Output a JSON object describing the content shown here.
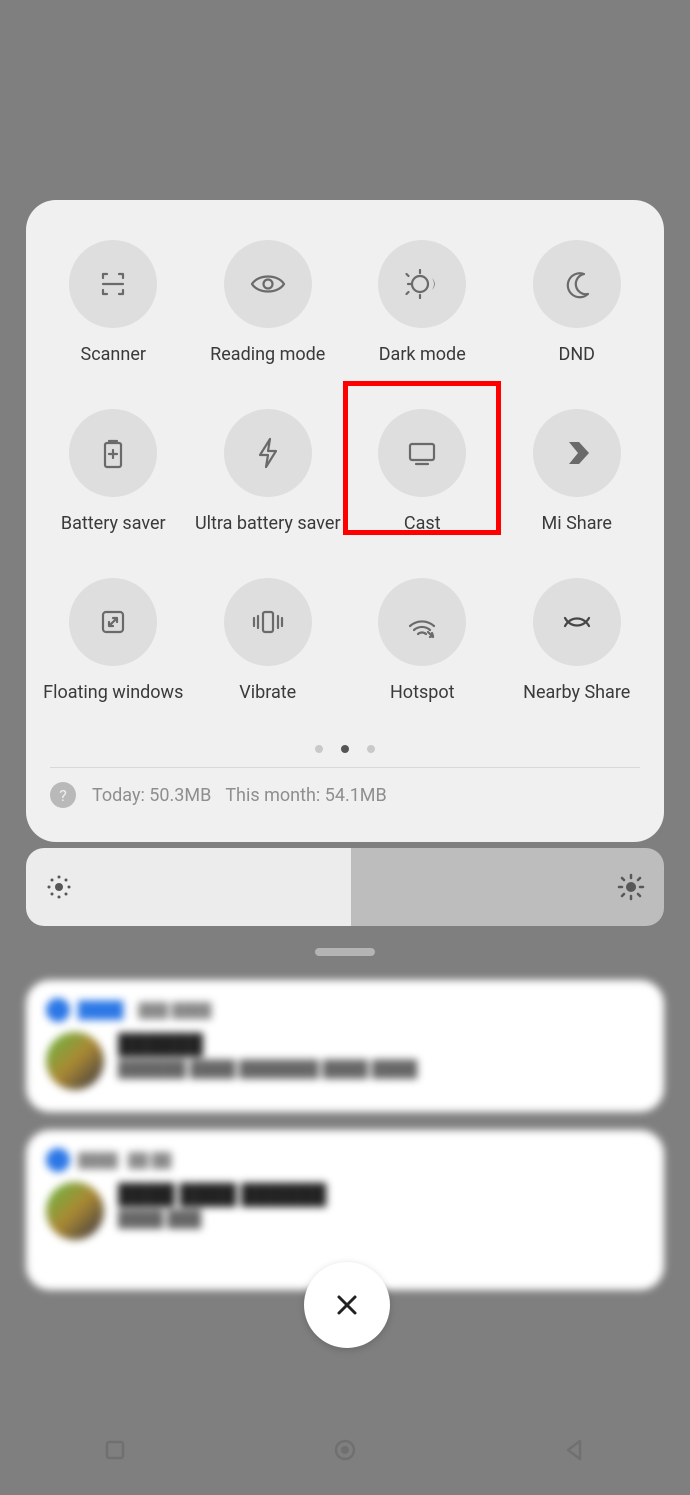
{
  "tiles": [
    {
      "label": "Scanner",
      "icon": "scanner-icon",
      "highlighted": false
    },
    {
      "label": "Reading mode",
      "icon": "eye-icon",
      "highlighted": false
    },
    {
      "label": "Dark mode",
      "icon": "dark-mode-icon",
      "highlighted": false
    },
    {
      "label": "DND",
      "icon": "moon-icon",
      "highlighted": false
    },
    {
      "label": "Battery saver",
      "icon": "battery-plus-icon",
      "highlighted": false
    },
    {
      "label": "Ultra battery saver",
      "icon": "bolt-icon",
      "highlighted": false
    },
    {
      "label": "Cast",
      "icon": "cast-icon",
      "highlighted": true
    },
    {
      "label": "Mi Share",
      "icon": "mishare-icon",
      "highlighted": false
    },
    {
      "label": "Floating windows",
      "icon": "floating-icon",
      "highlighted": false
    },
    {
      "label": "Vibrate",
      "icon": "vibrate-icon",
      "highlighted": false
    },
    {
      "label": "Hotspot",
      "icon": "hotspot-icon",
      "highlighted": false
    },
    {
      "label": "Nearby Share",
      "icon": "nearby-icon",
      "highlighted": false
    }
  ],
  "pagination": {
    "pages": 3,
    "active_index": 1
  },
  "data_usage": {
    "today_label": "Today: 50.3MB",
    "month_label": "This month: 54.1MB"
  },
  "brightness": {
    "percent": 51
  },
  "close_glyph": "✕"
}
